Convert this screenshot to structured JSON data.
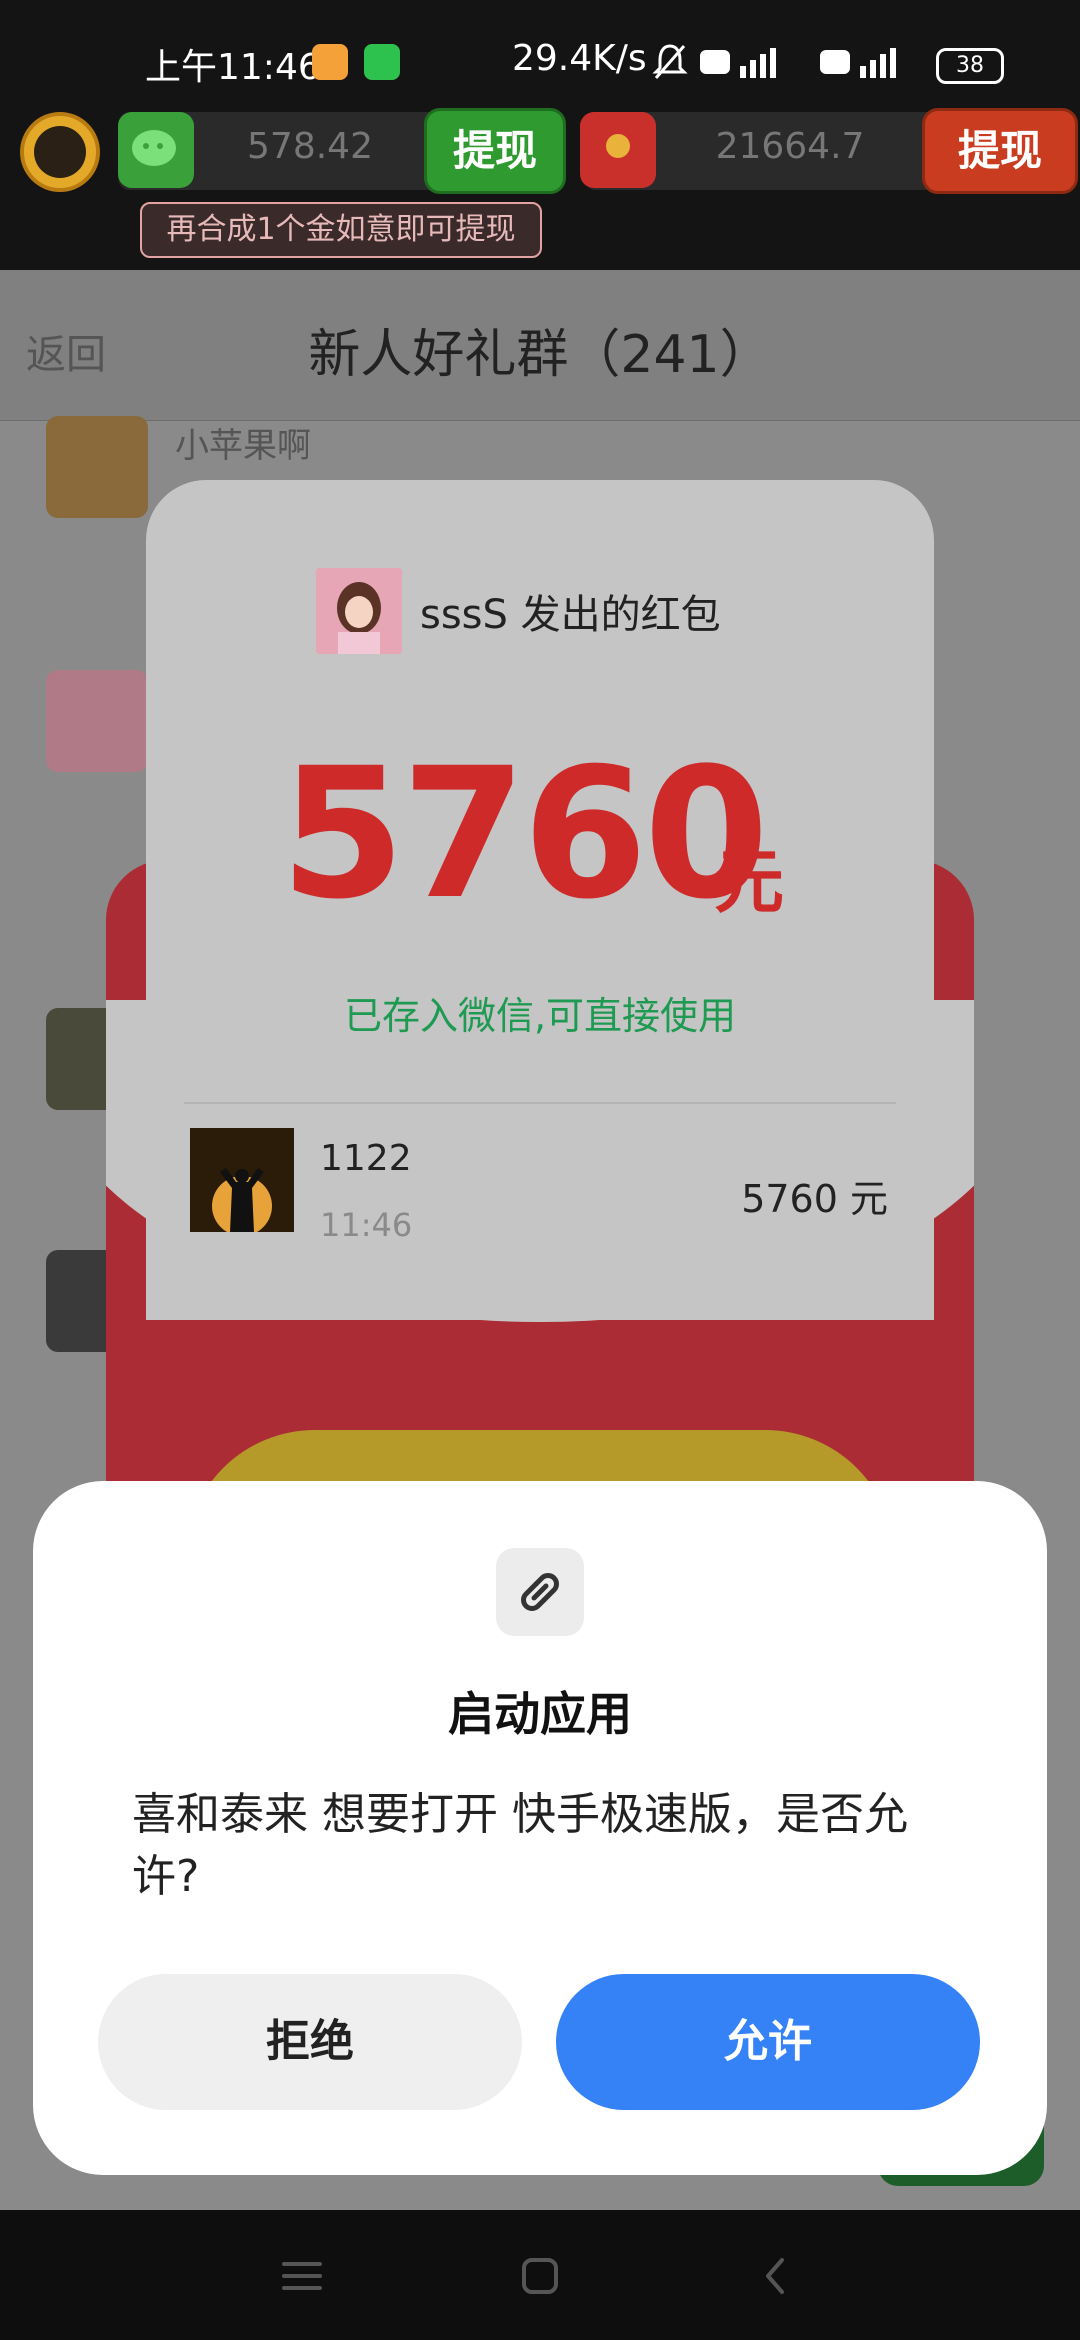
{
  "status_bar": {
    "time": "上午11:46",
    "network_speed": "29.4K/s",
    "battery": "38"
  },
  "game_bar": {
    "wechat_balance": "578.42",
    "wechat_withdraw_label": "提现",
    "coin_balance": "21664.7",
    "coin_withdraw_label": "提现",
    "hint": "再合成1个金如意即可提现"
  },
  "chat": {
    "back_label": "返回",
    "title": "新人好礼群（241）",
    "first_member_name": "小苹果啊"
  },
  "red_packet": {
    "sender_text": "sssS 发出的红包",
    "amount": "5760",
    "amount_unit": "元",
    "saved_text": "已存入微信,可直接使用",
    "record": {
      "name": "1122",
      "time": "11:46",
      "amount": "5760 元"
    }
  },
  "dialog": {
    "title": "启动应用",
    "message": "喜和泰来 想要打开 快手极速版，是否允许?",
    "deny_label": "拒绝",
    "allow_label": "允许"
  },
  "colors": {
    "accent_blue": "#3482f6",
    "packet_red": "#ac2c35",
    "amount_red": "#cf2a2a",
    "saved_green": "#1f9a52"
  }
}
